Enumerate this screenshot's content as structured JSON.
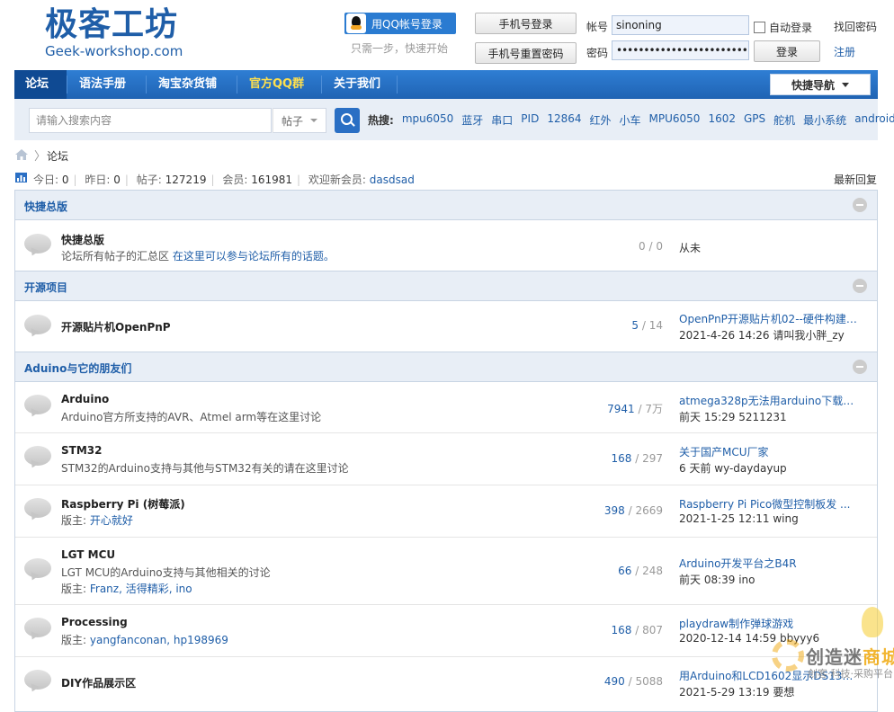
{
  "logo": {
    "cn": "极客工坊",
    "en": "Geek-workshop.com"
  },
  "login": {
    "qq_button": "用QQ帐号登录",
    "qq_tip": "只需一步，快速开始",
    "phone_login": "手机号登录",
    "phone_reset": "手机号重置密码",
    "username_label": "帐号",
    "username_value": "sinoning",
    "password_label": "密码",
    "password_value": "••••••••••••••••••••••••••••••",
    "auto_login": "自动登录",
    "login_button": "登录",
    "find_password": "找回密码",
    "register": "注册"
  },
  "nav": {
    "items": [
      "论坛",
      "语法手册",
      "淘宝杂货铺",
      "官方QQ群",
      "关于我们"
    ],
    "quick_nav": "快捷导航"
  },
  "search": {
    "placeholder": "请输入搜索内容",
    "type": "帖子",
    "hot_label": "热搜:",
    "hot_terms": [
      "mpu6050",
      "蓝牙",
      "串口",
      "PID",
      "12864",
      "红外",
      "小车",
      "MPU6050",
      "1602",
      "GPS",
      "舵机",
      "最小系统",
      "android"
    ]
  },
  "breadcrumb": {
    "forum": "论坛"
  },
  "stats": {
    "today_label": "今日:",
    "today": "0",
    "yesterday_label": "昨日:",
    "yesterday": "0",
    "posts_label": "帖子:",
    "posts": "127219",
    "members_label": "会员:",
    "members": "161981",
    "welcome_label": "欢迎新会员:",
    "new_member": "dasdsad",
    "latest_reply": "最新回复"
  },
  "categories": [
    {
      "title": "快捷总版",
      "forums": [
        {
          "name": "快捷总版",
          "desc": "论坛所有帖子的汇总区 ",
          "desc_link": "在这里可以参与论坛所有的话题。",
          "threads": "0",
          "posts": "0",
          "never": "从未"
        }
      ]
    },
    {
      "title": "开源项目",
      "forums": [
        {
          "name": "开源贴片机OpenPnP",
          "threads": "5",
          "posts": "14",
          "last_title": "OpenPnP开源贴片机02--硬件构建 ...",
          "last_meta": "2021-4-26 14:26 请叫我小胖_zy"
        }
      ]
    },
    {
      "title": "Aduino与它的朋友们",
      "forums": [
        {
          "name": "Arduino",
          "desc": "Arduino官方所支持的AVR、Atmel arm等在这里讨论",
          "threads": "7941",
          "posts": "7万",
          "last_title": "atmega328p无法用arduino下载程 ...",
          "last_meta": "前天 15:29 5211231"
        },
        {
          "name": "STM32",
          "desc": "STM32的Arduino支持与其他与STM32有关的请在这里讨论",
          "threads": "168",
          "posts": "297",
          "last_title": "关于国产MCU厂家",
          "last_meta": "6 天前 wy-daydayup"
        },
        {
          "name": "Raspberry Pi (树莓派)",
          "mod_label": "版主: ",
          "mods": "开心就好",
          "threads": "398",
          "posts": "2669",
          "last_title": "Raspberry Pi Pico微型控制板发 ...",
          "last_meta": "2021-1-25 12:11 wing"
        },
        {
          "name": "LGT MCU",
          "desc": "LGT MCU的Arduino支持与其他相关的讨论",
          "mod_label": "版主: ",
          "mods": "Franz, 活得精彩, ino",
          "threads": "66",
          "posts": "248",
          "last_title": "Arduino开发平台之B4R",
          "last_meta": "前天 08:39 ino"
        },
        {
          "name": "Processing",
          "mod_label": "版主: ",
          "mods": "yangfanconan, hp198969",
          "threads": "168",
          "posts": "807",
          "last_title": "playdraw制作弹球游戏",
          "last_meta": "2020-12-14 14:59 bbyyy6"
        },
        {
          "name": "DIY作品展示区",
          "threads": "490",
          "posts": "5088",
          "last_title": "用Arduino和LCD1602显示DS1302得 ...",
          "last_meta": "2021-5-29 13:19 要想"
        }
      ]
    }
  ],
  "watermark": {
    "text1": "创造迷",
    "text2": "商城",
    "sub": "创客·科技·采购平台"
  },
  "colors": {
    "nav_bg": "#2f7ed4",
    "nav_active": "#0f4a93",
    "link": "#1f5ea8",
    "highlight": "#ffe04d"
  }
}
